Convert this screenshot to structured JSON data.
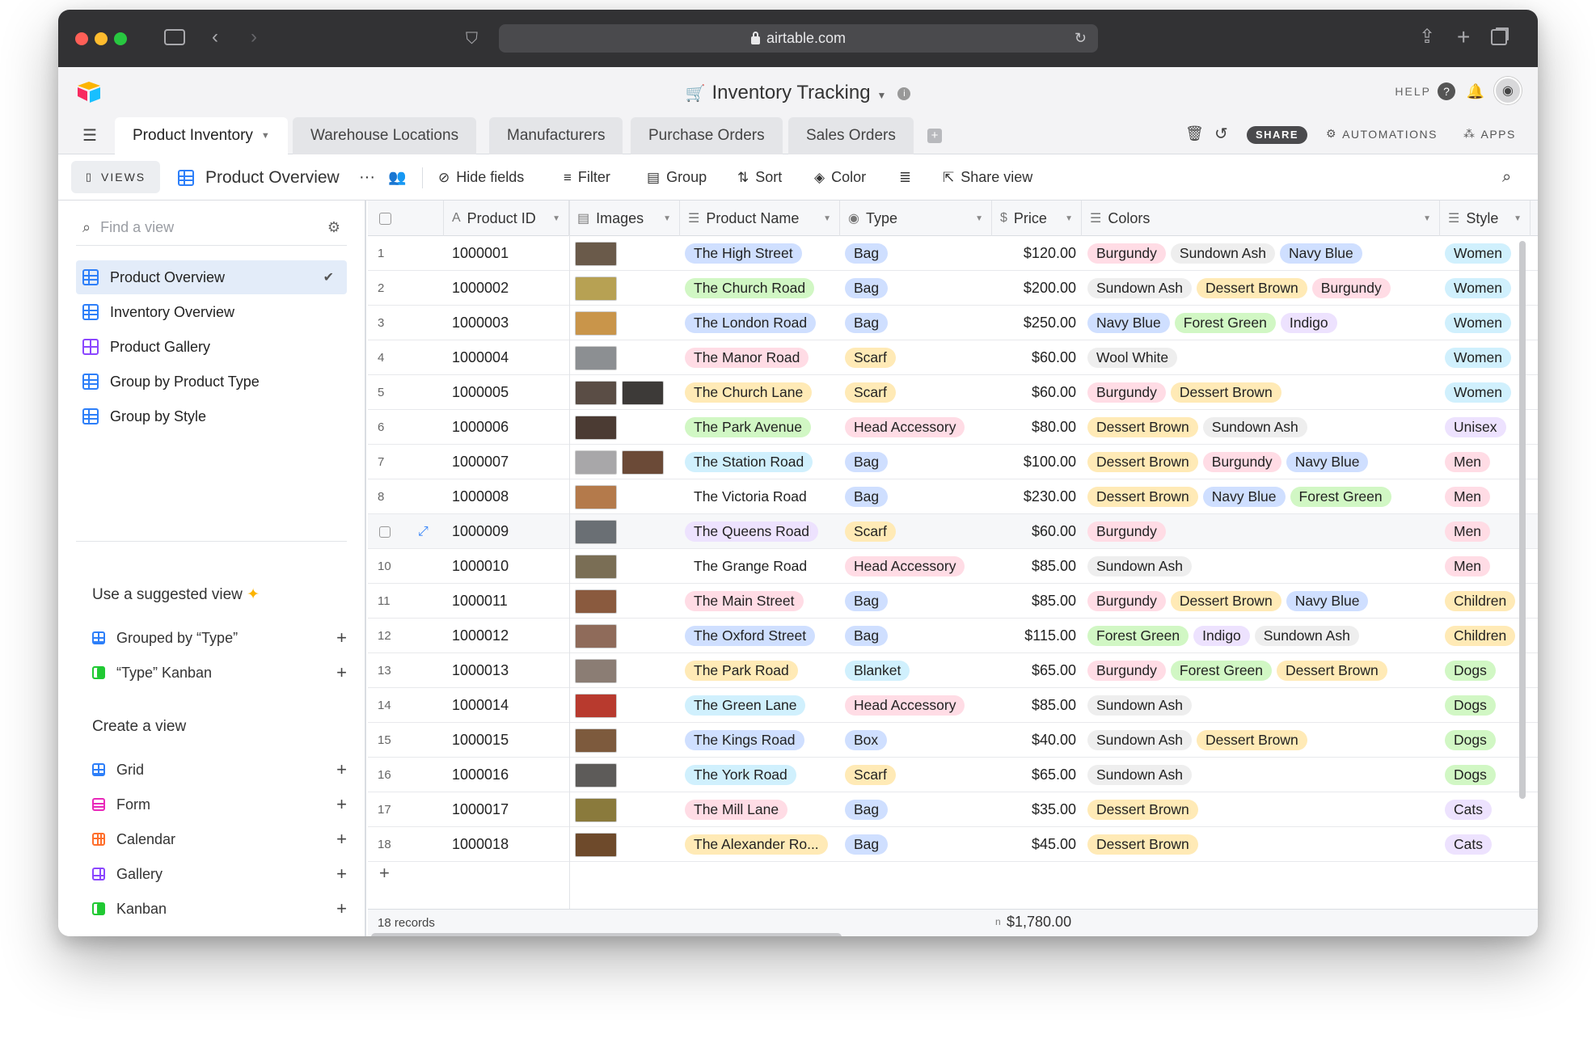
{
  "browser": {
    "url": "airtable.com"
  },
  "app": {
    "base_title": "Inventory Tracking",
    "help_label": "HELP",
    "tables": [
      "Product Inventory",
      "Warehouse Locations",
      "Manufacturers",
      "Purchase Orders",
      "Sales Orders"
    ],
    "active_table": "Product Inventory",
    "share_label": "SHARE",
    "automations_label": "AUTOMATIONS",
    "apps_label": "APPS"
  },
  "viewbar": {
    "views_label": "VIEWS",
    "current_view": "Product Overview",
    "hide_fields": "Hide fields",
    "filter": "Filter",
    "group": "Group",
    "sort": "Sort",
    "color": "Color",
    "share_view": "Share view"
  },
  "sidebar": {
    "find_placeholder": "Find a view",
    "views": [
      {
        "label": "Product Overview",
        "icon": "grid",
        "selected": true
      },
      {
        "label": "Inventory Overview",
        "icon": "grid"
      },
      {
        "label": "Product Gallery",
        "icon": "gallery"
      },
      {
        "label": "Group by Product Type",
        "icon": "grid"
      },
      {
        "label": "Group by Style",
        "icon": "grid"
      }
    ],
    "suggested_title": "Use a suggested view",
    "suggested": [
      {
        "label": "Grouped by “Type”",
        "icon": "grid"
      },
      {
        "label": "“Type” Kanban",
        "icon": "kanban"
      }
    ],
    "create_title": "Create a view",
    "create": [
      {
        "label": "Grid",
        "icon": "grid"
      },
      {
        "label": "Form",
        "icon": "form"
      },
      {
        "label": "Calendar",
        "icon": "calendar"
      },
      {
        "label": "Gallery",
        "icon": "gallery"
      },
      {
        "label": "Kanban",
        "icon": "kanban"
      }
    ]
  },
  "grid": {
    "columns": [
      "Product ID",
      "Images",
      "Product Name",
      "Type",
      "Price",
      "Colors",
      "Style"
    ],
    "rows": [
      {
        "n": "1",
        "id": "1000001",
        "images": [
          "#6a5a4a"
        ],
        "name": "The High Street",
        "name_color": "#cfdfff",
        "type": "Bag",
        "price": "$120.00",
        "colors": [
          "Burgundy",
          "Sundown Ash",
          "Navy Blue"
        ],
        "style": "Women"
      },
      {
        "n": "2",
        "id": "1000002",
        "images": [
          "#b7a153"
        ],
        "name": "The Church Road",
        "name_color": "#d1f7c4",
        "type": "Bag",
        "price": "$200.00",
        "colors": [
          "Sundown Ash",
          "Dessert Brown",
          "Burgundy"
        ],
        "style": "Women"
      },
      {
        "n": "3",
        "id": "1000003",
        "images": [
          "#c9954a"
        ],
        "name": "The London Road",
        "name_color": "#cfdfff",
        "type": "Bag",
        "price": "$250.00",
        "colors": [
          "Navy Blue",
          "Forest Green",
          "Indigo"
        ],
        "style": "Women"
      },
      {
        "n": "4",
        "id": "1000004",
        "images": [
          "#8c8f92"
        ],
        "name": "The Manor Road",
        "name_color": "#ffdce5",
        "type": "Scarf",
        "price": "$60.00",
        "colors": [
          "Wool White"
        ],
        "style": "Women"
      },
      {
        "n": "5",
        "id": "1000005",
        "images": [
          "#5a4d45",
          "#3d3a38"
        ],
        "name": "The Church Lane",
        "name_color": "#ffeab6",
        "type": "Scarf",
        "price": "$60.00",
        "colors": [
          "Burgundy",
          "Dessert Brown"
        ],
        "style": "Women"
      },
      {
        "n": "6",
        "id": "1000006",
        "images": [
          "#4b3b33"
        ],
        "name": "The Park Avenue",
        "name_color": "#d1f7c4",
        "type": "Head Accessory",
        "price": "$80.00",
        "colors": [
          "Dessert Brown",
          "Sundown Ash"
        ],
        "style": "Unisex"
      },
      {
        "n": "7",
        "id": "1000007",
        "images": [
          "#a8a7a9",
          "#6b4a37"
        ],
        "name": "The Station Road",
        "name_color": "#d0f0fd",
        "type": "Bag",
        "price": "$100.00",
        "colors": [
          "Dessert Brown",
          "Burgundy",
          "Navy Blue"
        ],
        "style": "Men"
      },
      {
        "n": "8",
        "id": "1000008",
        "images": [
          "#b47a4b"
        ],
        "name": "The Victoria Road",
        "name_color": "",
        "type": "Bag",
        "price": "$230.00",
        "colors": [
          "Dessert Brown",
          "Navy Blue",
          "Forest Green"
        ],
        "style": "Men"
      },
      {
        "n": "9",
        "id": "1000009",
        "images": [
          "#6a6f74"
        ],
        "name": "The Queens Road",
        "name_color": "#ede2fe",
        "type": "Scarf",
        "price": "$60.00",
        "colors": [
          "Burgundy"
        ],
        "style": "Men"
      },
      {
        "n": "10",
        "id": "1000010",
        "images": [
          "#7a6e55"
        ],
        "name": "The Grange Road",
        "name_color": "",
        "type": "Head Accessory",
        "price": "$85.00",
        "colors": [
          "Sundown Ash"
        ],
        "style": "Men"
      },
      {
        "n": "11",
        "id": "1000011",
        "images": [
          "#8a5a3e"
        ],
        "name": "The Main Street",
        "name_color": "#ffdce5",
        "type": "Bag",
        "price": "$85.00",
        "colors": [
          "Burgundy",
          "Dessert Brown",
          "Navy Blue"
        ],
        "style": "Children"
      },
      {
        "n": "12",
        "id": "1000012",
        "images": [
          "#8f6b5a"
        ],
        "name": "The Oxford Street",
        "name_color": "#cfdfff",
        "type": "Bag",
        "price": "$115.00",
        "colors": [
          "Forest Green",
          "Indigo",
          "Sundown Ash"
        ],
        "style": "Children"
      },
      {
        "n": "13",
        "id": "1000013",
        "images": [
          "#8b7d74"
        ],
        "name": "The Park Road",
        "name_color": "#ffeab6",
        "type": "Blanket",
        "price": "$65.00",
        "colors": [
          "Burgundy",
          "Forest Green",
          "Dessert Brown"
        ],
        "style": "Dogs"
      },
      {
        "n": "14",
        "id": "1000014",
        "images": [
          "#b83a2e"
        ],
        "name": "The Green Lane",
        "name_color": "#d0f0fd",
        "type": "Head Accessory",
        "price": "$85.00",
        "colors": [
          "Sundown Ash"
        ],
        "style": "Dogs"
      },
      {
        "n": "15",
        "id": "1000015",
        "images": [
          "#7d5a3d"
        ],
        "name": "The Kings Road",
        "name_color": "#cfdfff",
        "type": "Box",
        "price": "$40.00",
        "colors": [
          "Sundown Ash",
          "Dessert Brown"
        ],
        "style": "Dogs"
      },
      {
        "n": "16",
        "id": "1000016",
        "images": [
          "#5d5b59"
        ],
        "name": "The York Road",
        "name_color": "#d0f0fd",
        "type": "Scarf",
        "price": "$65.00",
        "colors": [
          "Sundown Ash"
        ],
        "style": "Dogs"
      },
      {
        "n": "17",
        "id": "1000017",
        "images": [
          "#8a7a3c"
        ],
        "name": "The Mill Lane",
        "name_color": "#ffdce5",
        "type": "Bag",
        "price": "$35.00",
        "colors": [
          "Dessert Brown"
        ],
        "style": "Cats"
      },
      {
        "n": "18",
        "id": "1000018",
        "images": [
          "#6e4a2b"
        ],
        "name": "The Alexander Ro...",
        "name_color": "#ffeab6",
        "type": "Bag",
        "price": "$45.00",
        "colors": [
          "Dessert Brown"
        ],
        "style": "Cats"
      }
    ],
    "type_colors": {
      "Bag": "#cfdfff",
      "Scarf": "#ffeab6",
      "Head Accessory": "#ffdce5",
      "Blanket": "#d0f0fd",
      "Box": "#cfdfff"
    },
    "color_colors": {
      "Burgundy": "#ffdce5",
      "Sundown Ash": "#eeeeee",
      "Navy Blue": "#cfdfff",
      "Dessert Brown": "#ffeab6",
      "Forest Green": "#d1f7c4",
      "Indigo": "#ede2fe",
      "Wool White": "#eeeeee"
    },
    "style_colors": {
      "Women": "#d0f0fd",
      "Men": "#ffdce5",
      "Unisex": "#ede2fe",
      "Children": "#ffeab6",
      "Dogs": "#d1f7c4",
      "Cats": "#ede2fe"
    },
    "records_label": "18 records",
    "sum_prefix": "n",
    "price_sum": "$1,780.00"
  }
}
